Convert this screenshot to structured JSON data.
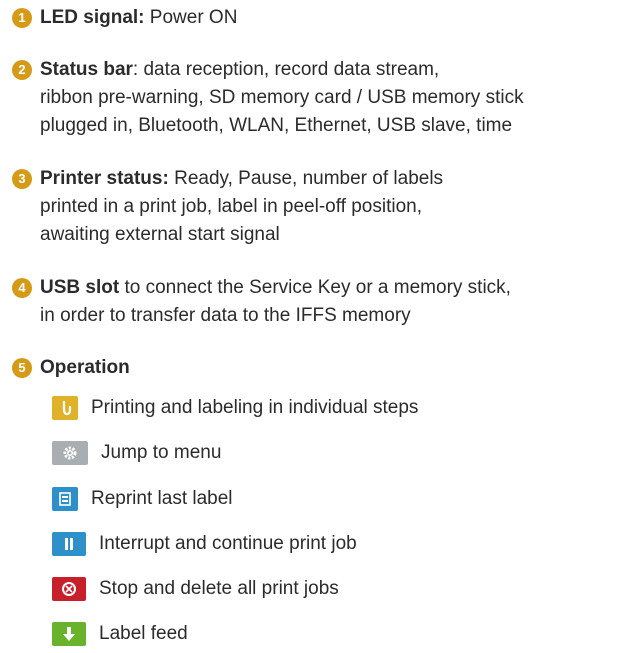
{
  "accent_color": "#d59a17",
  "items": [
    {
      "number": "1",
      "title": "LED signal:",
      "lines": [
        " Power ON"
      ]
    },
    {
      "number": "2",
      "title": "Status bar",
      "lines": [
        ": data reception, record data stream,",
        "ribbon pre-warning, SD memory card / USB memory stick",
        "plugged in, Bluetooth, WLAN, Ethernet, USB slave, time"
      ]
    },
    {
      "number": "3",
      "title": "Printer status:",
      "lines": [
        " Ready, Pause, number of labels",
        "printed in a print job, label in peel-off position,",
        "awaiting external start signal"
      ]
    },
    {
      "number": "4",
      "title": "USB slot",
      "lines": [
        " to connect the Service Key or a memory stick,",
        "in order to transfer data to the IFFS memory"
      ]
    },
    {
      "number": "5",
      "title": "Operation",
      "lines": []
    }
  ],
  "operations": [
    {
      "icon": "hand-icon",
      "color": "#e0b22a",
      "label": "Printing and labeling in individual steps"
    },
    {
      "icon": "gear-icon",
      "color": "#a9aeb2",
      "label": "Jump to menu"
    },
    {
      "icon": "reprint-icon",
      "color": "#2f8fc8",
      "label": "Reprint last label"
    },
    {
      "icon": "pause-icon",
      "color": "#2f8fc8",
      "label": "Interrupt and continue print job"
    },
    {
      "icon": "cancel-icon",
      "color": "#c8202b",
      "label": "Stop and delete all print jobs"
    },
    {
      "icon": "arrow-down-icon",
      "color": "#69b22c",
      "label": "Label feed"
    }
  ]
}
